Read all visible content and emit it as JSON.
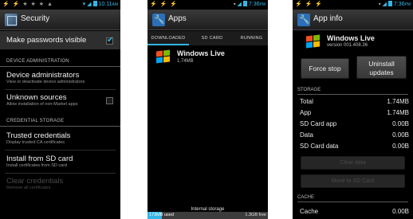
{
  "status_time_1": "10:11",
  "status_ampm_1": "AM",
  "status_time_2": "7:36",
  "status_ampm_2": "PM",
  "status_time_3": "7:36",
  "status_ampm_3": "PM",
  "security": {
    "title": "Security",
    "make_passwords_visible": "Make passwords visible",
    "make_passwords_visible_checked": true,
    "section_device_admin": "DEVICE ADMINISTRATION",
    "device_admins_title": "Device administrators",
    "device_admins_sub": "View or deactivate device administrators",
    "unknown_sources_title": "Unknown sources",
    "unknown_sources_sub": "Allow installation of non-Market apps",
    "unknown_sources_checked": false,
    "section_credential_storage": "CREDENTIAL STORAGE",
    "trusted_title": "Trusted credentials",
    "trusted_sub": "Display trusted CA certificates",
    "install_title": "Install from SD card",
    "install_sub": "Install certificates from SD card",
    "clear_title": "Clear credentials",
    "clear_sub": "Remove all certificates"
  },
  "apps": {
    "title": "Apps",
    "tabs": [
      "DOWNLOADED",
      "SD CARD",
      "RUNNING"
    ],
    "active_tab": "DOWNLOADED",
    "item_name": "Windows Live",
    "item_size": "1.74MB",
    "storage_label": "Internal storage",
    "storage_used": "173MB used",
    "storage_free": "1.3GB free"
  },
  "app_info": {
    "title": "App info",
    "app_name": "Windows Live",
    "app_version": "version 001.408.36",
    "force_stop": "Force stop",
    "uninstall_line1": "Uninstall",
    "uninstall_line2": "updates",
    "section_storage": "STORAGE",
    "rows": [
      {
        "label": "Total",
        "value": "1.74MB"
      },
      {
        "label": "App",
        "value": "1.74MB"
      },
      {
        "label": "SD Card app",
        "value": "0.00B"
      },
      {
        "label": "Data",
        "value": "0.00B"
      },
      {
        "label": "SD Card data",
        "value": "0.00B"
      }
    ],
    "clear_data": "Clear data",
    "move_to_sd": "Move to SD Card",
    "section_cache": "CACHE",
    "cache_label": "Cache",
    "cache_value": "0.00B"
  },
  "colors": {
    "accent": "#33b5e5",
    "background": "#000000"
  }
}
